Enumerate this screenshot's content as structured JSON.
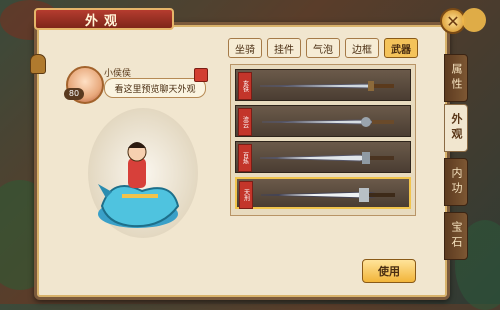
{
  "window": {
    "title": "外观",
    "close_symbol": "✕"
  },
  "player": {
    "name": "小侯侯",
    "level": "80",
    "bubble_text": "看这里预览聊天外观"
  },
  "category_tabs": [
    {
      "label": "坐骑",
      "active": false
    },
    {
      "label": "挂件",
      "active": false
    },
    {
      "label": "气泡",
      "active": false
    },
    {
      "label": "边框",
      "active": false
    },
    {
      "label": "武器",
      "active": true
    }
  ],
  "items": [
    {
      "tag": "玄铁"
    },
    {
      "tag": "流云"
    },
    {
      "tag": "百炼"
    },
    {
      "tag": "天刑"
    }
  ],
  "use_button": "使用",
  "side_tabs": [
    {
      "label": "属性",
      "active": false
    },
    {
      "label": "外观",
      "active": true
    },
    {
      "label": "内功",
      "active": false
    },
    {
      "label": "宝石",
      "active": false
    }
  ],
  "colors": {
    "accent": "#f4c35a",
    "title_bar": "#b53c2f",
    "panel": "#f1e6cf"
  }
}
